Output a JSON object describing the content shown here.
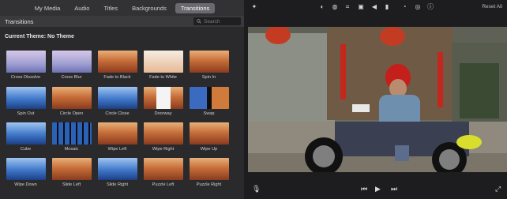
{
  "tabs": [
    {
      "label": "My Media",
      "active": false
    },
    {
      "label": "Audio",
      "active": false
    },
    {
      "label": "Titles",
      "active": false
    },
    {
      "label": "Backgrounds",
      "active": false
    },
    {
      "label": "Transitions",
      "active": true
    }
  ],
  "browser": {
    "section_title": "Transitions",
    "search_placeholder": "Search",
    "theme_label": "Current Theme: No Theme"
  },
  "transitions": [
    {
      "label": "Cross Dissolve",
      "style": "soft"
    },
    {
      "label": "Cross Blur",
      "style": "soft"
    },
    {
      "label": "Fade to Black",
      "style": "warm"
    },
    {
      "label": "Fade to White",
      "style": "warm"
    },
    {
      "label": "Spin In",
      "style": "warm"
    },
    {
      "label": "Spin Out",
      "style": "cool"
    },
    {
      "label": "Circle Open",
      "style": "warm"
    },
    {
      "label": "Circle Close",
      "style": "cool"
    },
    {
      "label": "Doorway",
      "style": "warm"
    },
    {
      "label": "Swap",
      "style": "black"
    },
    {
      "label": "Cube",
      "style": "cool"
    },
    {
      "label": "Mosaic",
      "style": "cool"
    },
    {
      "label": "Wipe Left",
      "style": "warm"
    },
    {
      "label": "Wipe Right",
      "style": "warm"
    },
    {
      "label": "Wipe Up",
      "style": "warm"
    },
    {
      "label": "Wipe Down",
      "style": "cool"
    },
    {
      "label": "Slide Left",
      "style": "warm"
    },
    {
      "label": "Slide Right",
      "style": "cool"
    },
    {
      "label": "Puzzle Left",
      "style": "warm"
    },
    {
      "label": "Puzzle Right",
      "style": "warm"
    }
  ],
  "viewer": {
    "reset_label": "Reset All",
    "toolbar_icons": [
      "magic-wand-icon",
      "color-balance-icon",
      "color-palette-icon",
      "crop-icon",
      "camera-icon",
      "volume-icon",
      "equalizer-icon",
      "speed-icon",
      "noise-icon",
      "info-icon"
    ],
    "controls": [
      "microphone-icon",
      "skip-back-icon",
      "play-icon",
      "skip-forward-icon",
      "fullscreen-icon"
    ]
  }
}
